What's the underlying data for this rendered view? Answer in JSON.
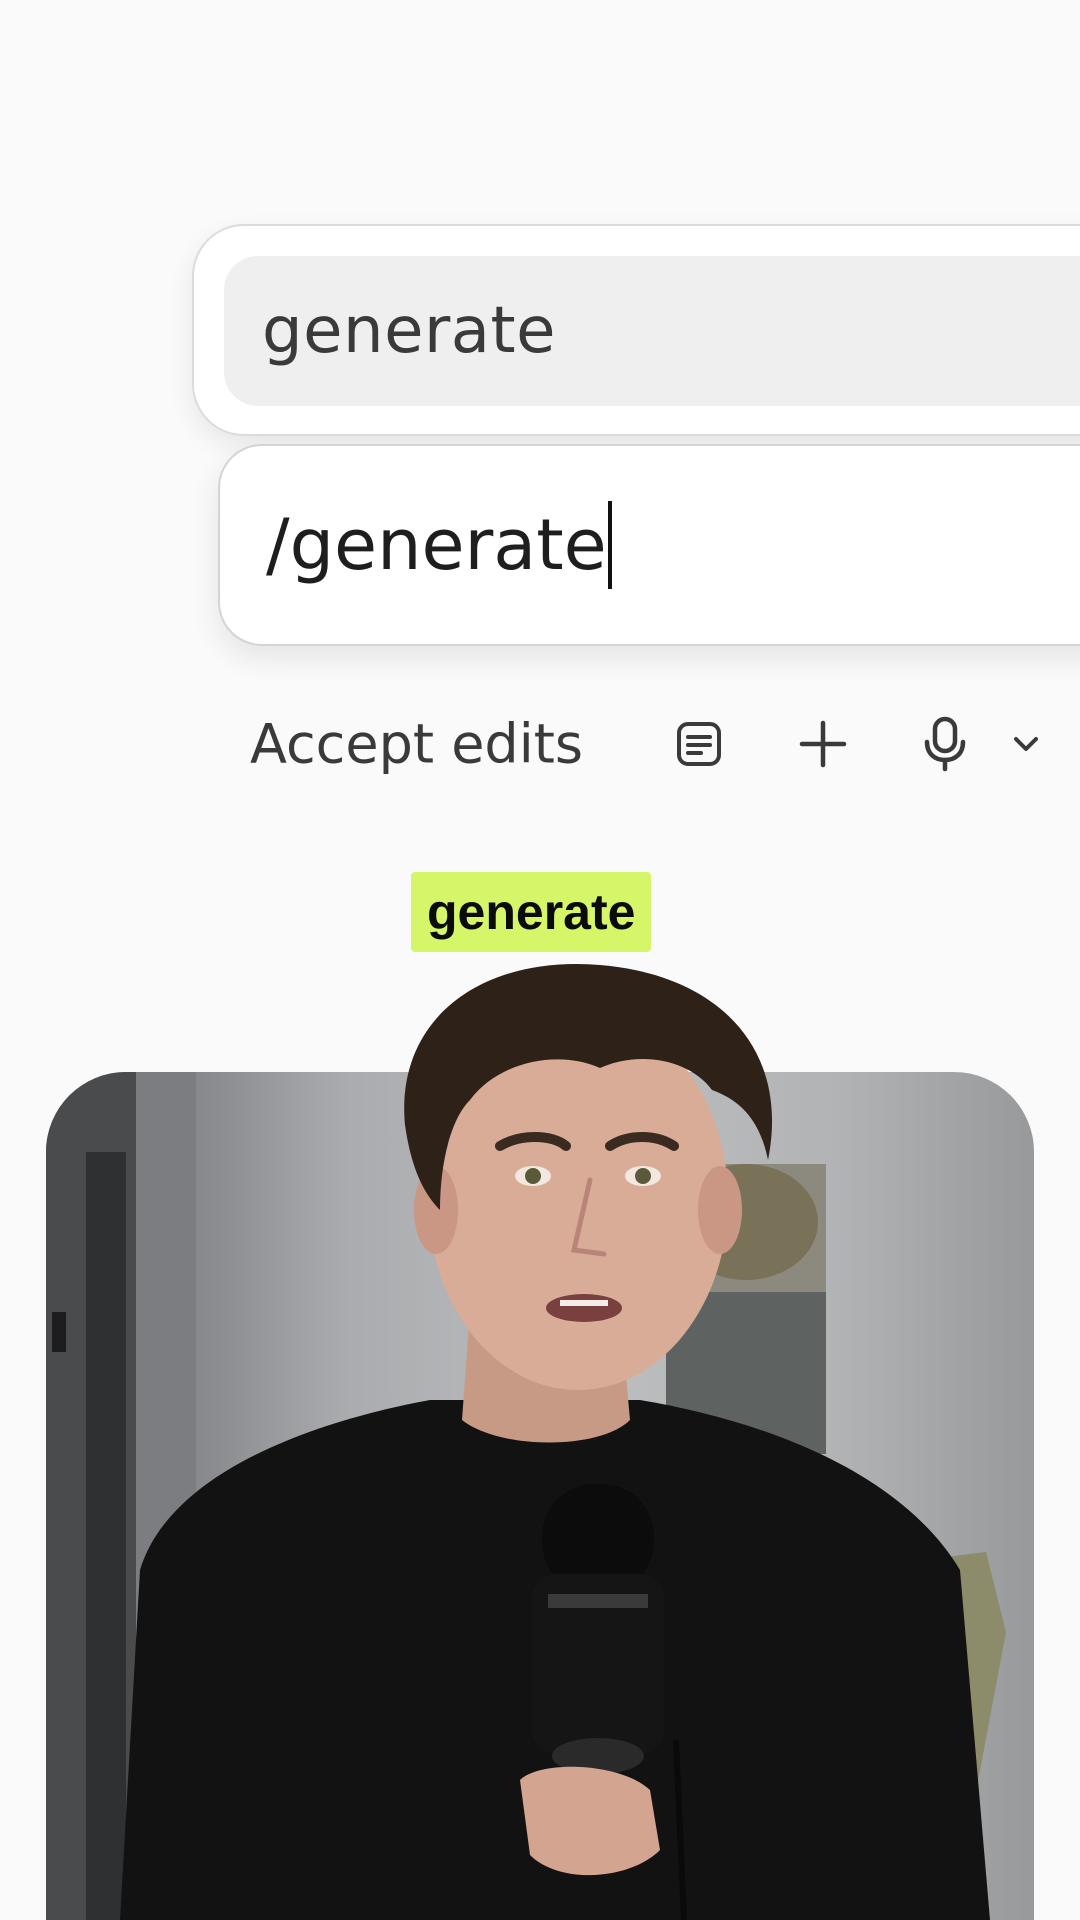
{
  "suggestion": {
    "text": "generate"
  },
  "prompt": {
    "value": "/generate"
  },
  "toolbar": {
    "mode_label": "Accept edits",
    "icons": [
      "document-icon",
      "plus-icon",
      "microphone-icon",
      "chevron-down-icon"
    ]
  },
  "caption": {
    "text": "generate",
    "background": "#d6f66a"
  }
}
